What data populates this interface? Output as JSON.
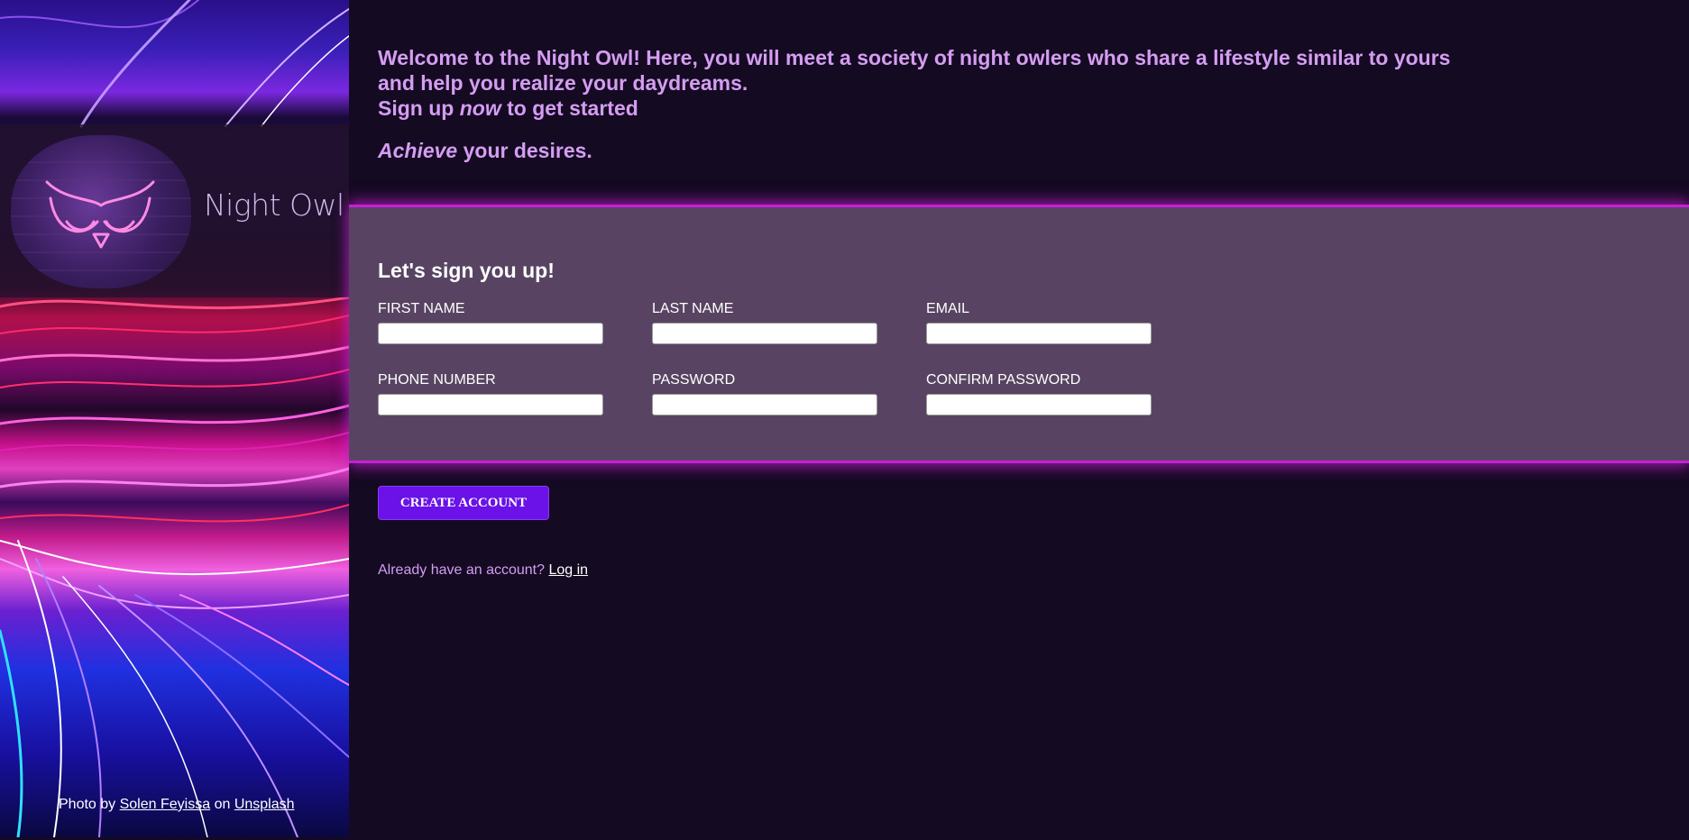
{
  "brand": {
    "name": "Night Owl",
    "logo_icon": "owl-mask-icon"
  },
  "credit": {
    "prefix": "Photo by",
    "author": "Solen Feyissa",
    "middle": "on",
    "site": "Unsplash"
  },
  "intro": {
    "line1": "Welcome to the Night Owl! Here, you will meet a society of night owlers who share a lifestyle similar to yours and help you realize your daydreams.",
    "signup_prefix": "Sign up",
    "signup_emph": "now",
    "signup_suffix": "to get started",
    "tag_emph": "Achieve",
    "tag_rest": "your desires."
  },
  "form": {
    "title": "Let's sign you up!",
    "fields": [
      {
        "label": "FIRST NAME",
        "value": ""
      },
      {
        "label": "LAST NAME",
        "value": ""
      },
      {
        "label": "EMAIL",
        "value": ""
      },
      {
        "label": "PHONE NUMBER",
        "value": ""
      },
      {
        "label": "PASSWORD",
        "value": ""
      },
      {
        "label": "CONFIRM PASSWORD",
        "value": ""
      }
    ],
    "submit_label": "CREATE ACCOUNT"
  },
  "login": {
    "prompt": "Already have an account?",
    "link": "Log in"
  },
  "colors": {
    "background": "#140a22",
    "accent_text": "#d59df2",
    "form_band": "#584462",
    "glow": "#c81fd6",
    "button": "#6a12e8"
  }
}
